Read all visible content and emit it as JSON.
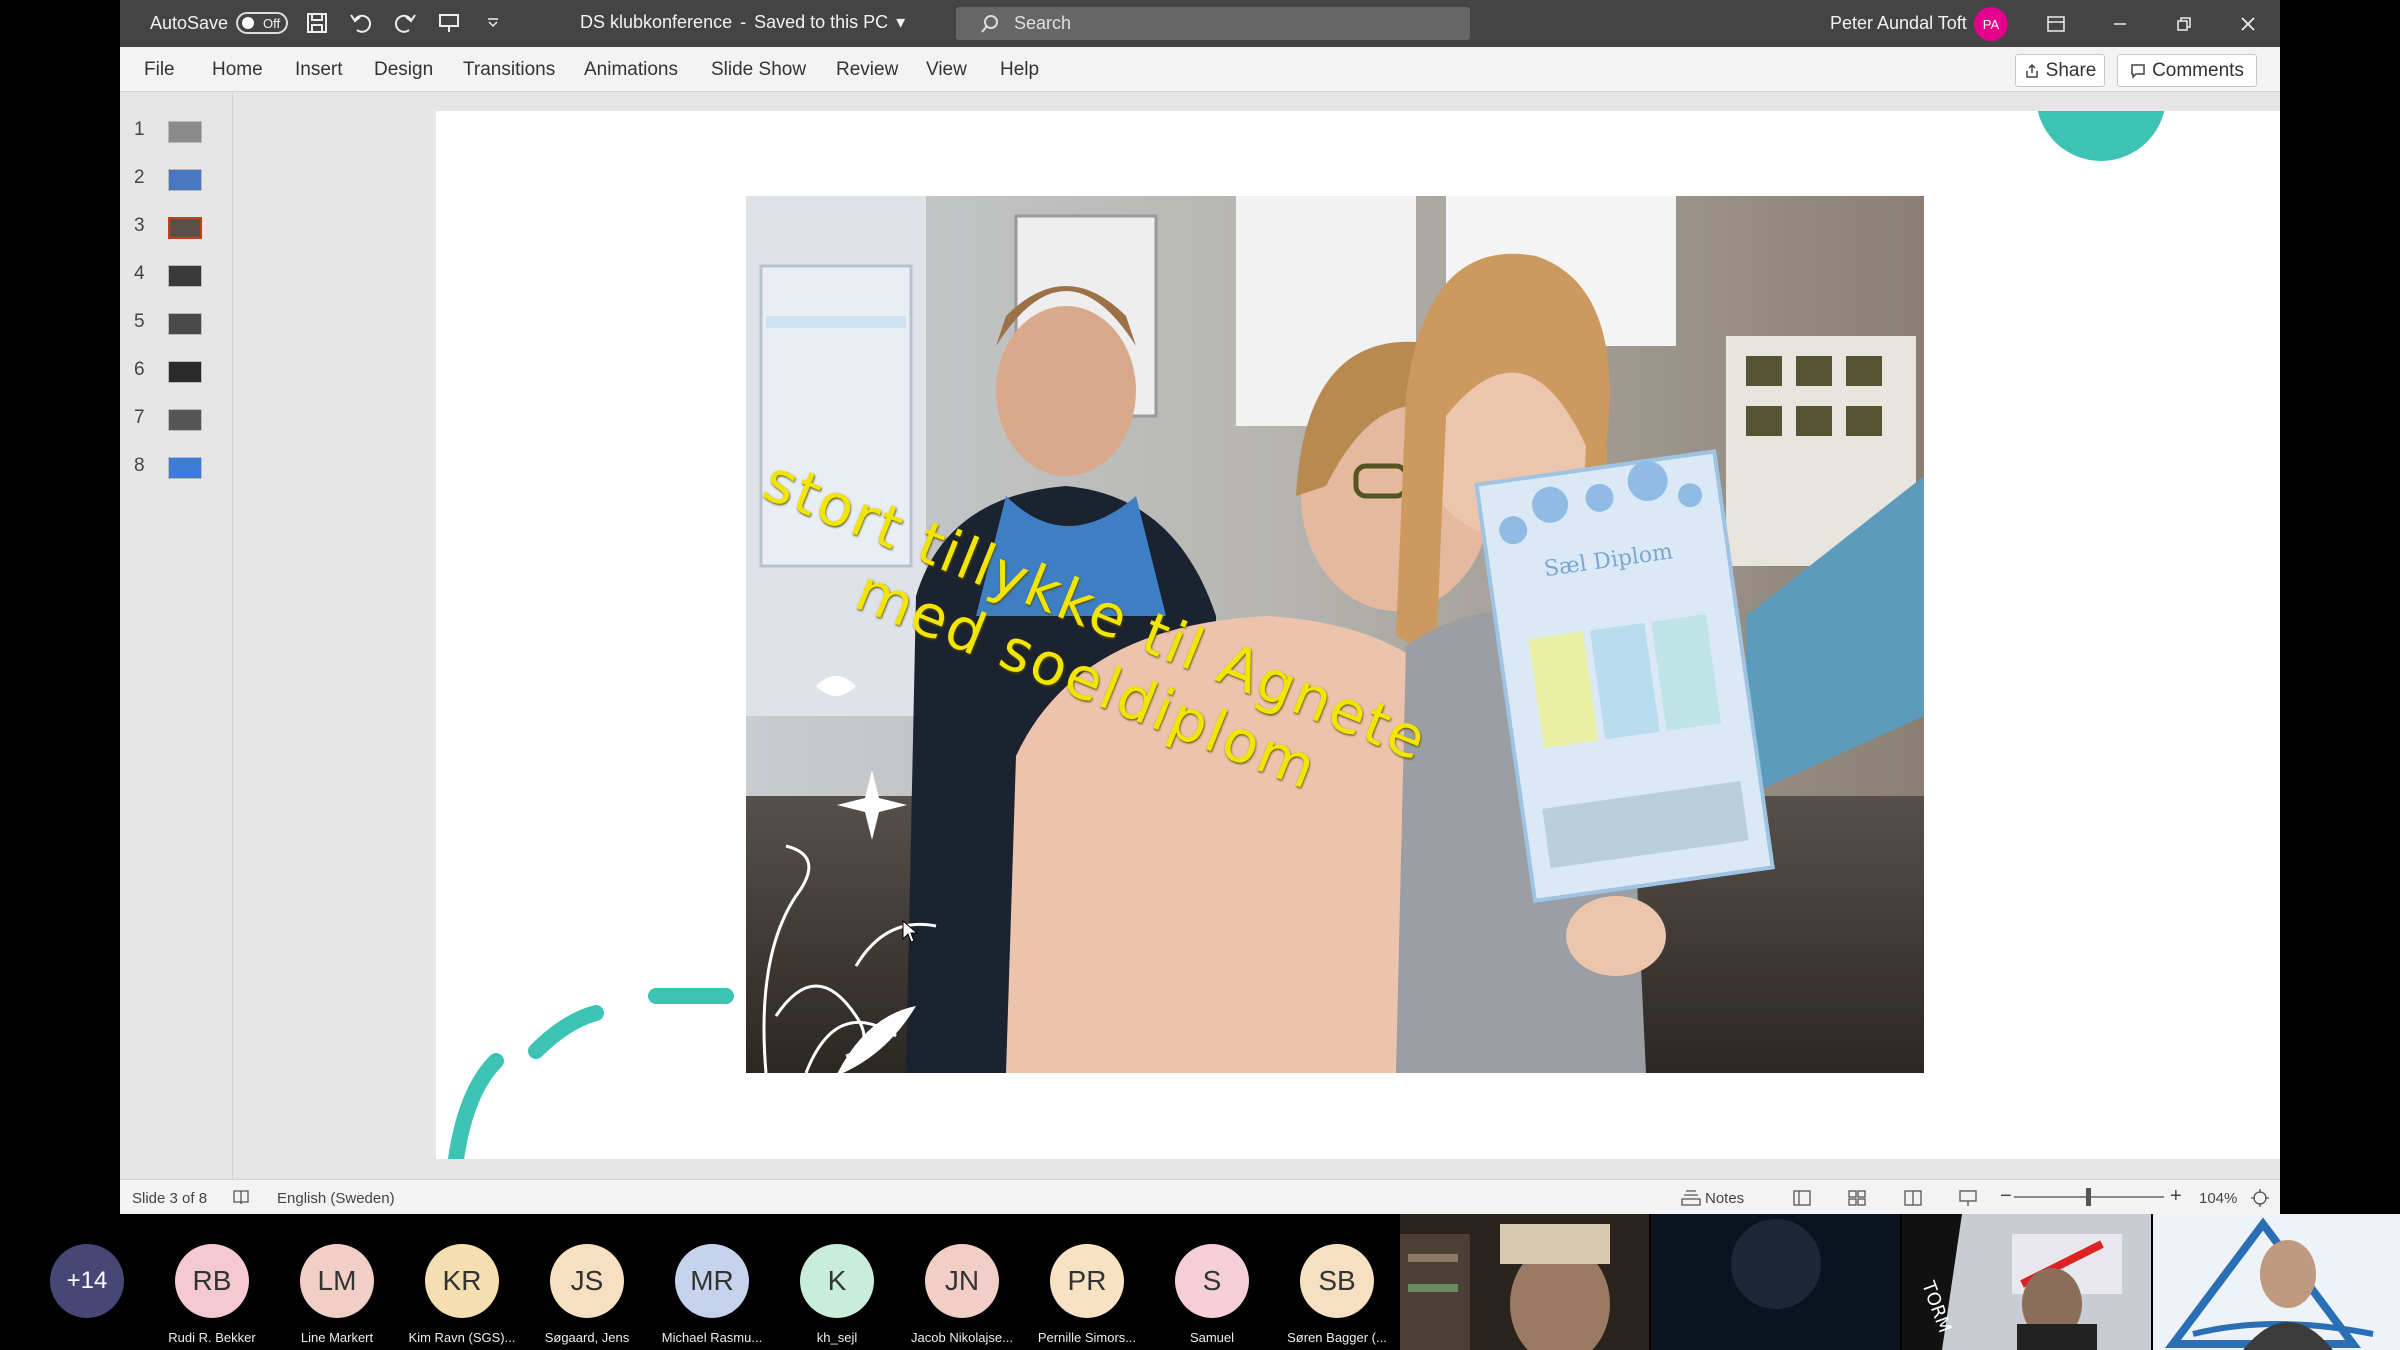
{
  "window": {
    "autosave_label": "AutoSave",
    "autosave_state": "Off",
    "doc_title": "DS klubkonference",
    "save_status": "Saved to this PC",
    "search_placeholder": "Search",
    "user_name": "Peter Aundal Toft",
    "user_initials": "PA"
  },
  "menu": {
    "items": [
      "File",
      "Home",
      "Insert",
      "Design",
      "Transitions",
      "Animations",
      "Slide Show",
      "Review",
      "View",
      "Help"
    ],
    "share": "Share",
    "comments": "Comments"
  },
  "thumbnails": [
    {
      "num": "1",
      "color": "#8a8a8a"
    },
    {
      "num": "2",
      "color": "#4a78c0"
    },
    {
      "num": "3",
      "color": "#5a5048"
    },
    {
      "num": "4",
      "color": "#3a3a3a"
    },
    {
      "num": "5",
      "color": "#4a4a4a"
    },
    {
      "num": "6",
      "color": "#2a2a2a"
    },
    {
      "num": "7",
      "color": "#555555"
    },
    {
      "num": "8",
      "color": "#3d7bd9"
    }
  ],
  "slide": {
    "text_line1": "stort tillykke til Agnete",
    "text_line2": "med soeldiplom",
    "diploma_title": "Sæl Diplom"
  },
  "status": {
    "slide_info": "Slide 3 of 8",
    "language": "English (Sweden)",
    "notes": "Notes",
    "zoom": "104%"
  },
  "participants": {
    "more": "+14",
    "people": [
      {
        "initials": "RB",
        "name": "Rudi R. Bekker",
        "color": "#f5c9d2"
      },
      {
        "initials": "LM",
        "name": "Line Markert",
        "color": "#f2cfc6"
      },
      {
        "initials": "KR",
        "name": "Kim Ravn (SGS)...",
        "color": "#f5deb0"
      },
      {
        "initials": "JS",
        "name": "Søgaard, Jens",
        "color": "#f7e0c1"
      },
      {
        "initials": "MR",
        "name": "Michael Rasmu...",
        "color": "#c6d3ec"
      },
      {
        "initials": "K",
        "name": "kh_sejl",
        "color": "#c8edd9"
      },
      {
        "initials": "JN",
        "name": "Jacob Nikolajse...",
        "color": "#f2cfc6"
      },
      {
        "initials": "PR",
        "name": "Pernille Simors...",
        "color": "#f7e3c4"
      },
      {
        "initials": "S",
        "name": "Samuel",
        "color": "#f5cfd8"
      },
      {
        "initials": "SB",
        "name": "Søren Bagger (...",
        "color": "#f7e0c1"
      }
    ]
  }
}
